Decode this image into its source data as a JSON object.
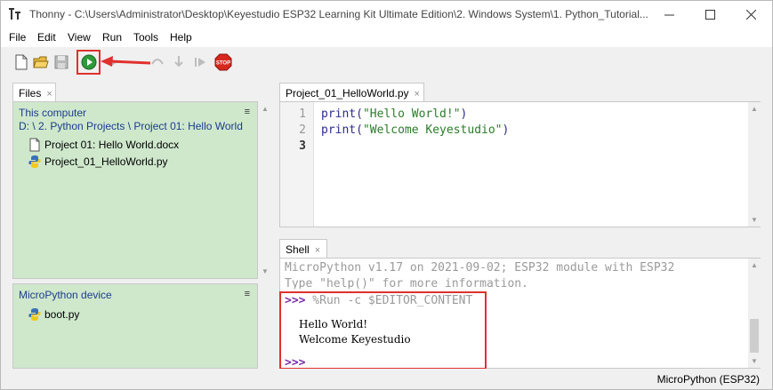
{
  "window": {
    "title": "Thonny  -  C:\\Users\\Administrator\\Desktop\\Keyestudio ESP32 Learning Kit Ultimate Edition\\2. Windows  System\\1. Python_Tutorial..."
  },
  "menu": [
    "File",
    "Edit",
    "View",
    "Run",
    "Tools",
    "Help"
  ],
  "toolbar": {
    "new": "new-file-icon",
    "open": "open-folder-icon",
    "save": "save-icon",
    "run": "run-icon",
    "stop_label": "STOP"
  },
  "files_panel": {
    "tab_label": "Files",
    "tab_close": "×",
    "section_title": "This computer",
    "menu_glyph": "≡",
    "path": "D: \\ 2. Python Projects \\ Project 01:  Hello World",
    "items": [
      {
        "name": "Project 01:   Hello World.docx",
        "icon": "document-icon"
      },
      {
        "name": "Project_01_HelloWorld.py",
        "icon": "python-icon"
      }
    ]
  },
  "device_panel": {
    "section_title": "MicroPython device",
    "menu_glyph": "≡",
    "items": [
      {
        "name": "boot.py",
        "icon": "python-icon"
      }
    ]
  },
  "editor": {
    "tab_label": "Project_01_HelloWorld.py",
    "tab_close": "×",
    "line_numbers": [
      "1",
      "2",
      "3"
    ],
    "lines": [
      {
        "fn": "print(",
        "str": "\"Hello World!\"",
        "end": ")"
      },
      {
        "fn": "print(",
        "str": "\"Welcome Keyestudio\"",
        "end": ")"
      }
    ]
  },
  "shell": {
    "tab_label": "Shell",
    "tab_close": "×",
    "banner_1": "MicroPython v1.17 on 2021-09-02; ESP32 module with ESP32",
    "banner_2": "Type \"help()\" for more information.",
    "prompt": ">>>",
    "command": " %Run -c $EDITOR_CONTENT",
    "output": [
      "Hello World!",
      "Welcome Keyestudio"
    ]
  },
  "status": {
    "interpreter": "MicroPython (ESP32)"
  },
  "colors": {
    "highlight": "#e0312e",
    "panel_green": "#cfe8cc",
    "prompt_purple": "#7a2fa8"
  }
}
